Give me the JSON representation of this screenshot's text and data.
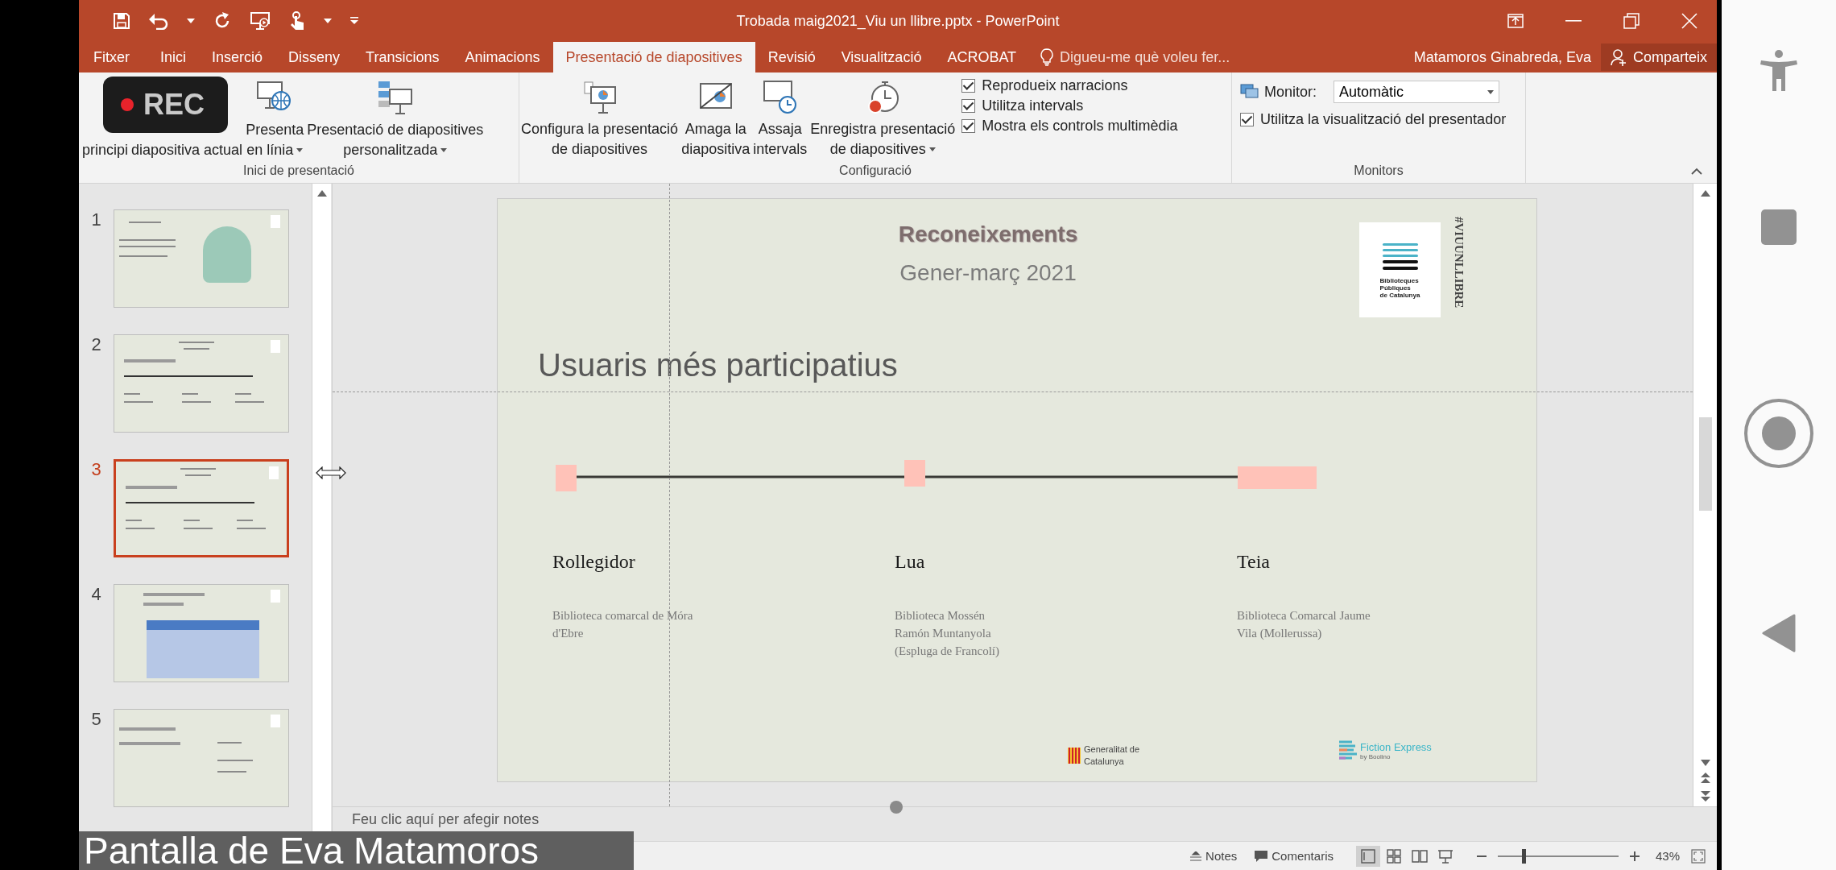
{
  "window": {
    "title": "Trobada maig2021_Viu un llibre.pptx - PowerPoint"
  },
  "tabs": [
    {
      "label": "Fitxer",
      "selected": false
    },
    {
      "label": "Inici",
      "selected": false
    },
    {
      "label": "Inserció",
      "selected": false
    },
    {
      "label": "Disseny",
      "selected": false
    },
    {
      "label": "Transicions",
      "selected": false
    },
    {
      "label": "Animacions",
      "selected": false
    },
    {
      "label": "Presentació de diapositives",
      "selected": true
    },
    {
      "label": "Revisió",
      "selected": false
    },
    {
      "label": "Visualització",
      "selected": false
    },
    {
      "label": "ACROBAT",
      "selected": false
    }
  ],
  "tell_me": {
    "placeholder": "Digueu-me què voleu fer..."
  },
  "user": "Matamoros Ginabreda, Eva",
  "share_button": "Comparteix",
  "recording_badge": "REC",
  "ribbon": {
    "start_group": {
      "label": "Inici de presentació",
      "buttons": [
        {
          "kind": "text",
          "lines": [
            "principi"
          ],
          "dropdown": false
        },
        {
          "kind": "text",
          "lines": [
            "diapositiva actual"
          ],
          "dropdown": false
        },
        {
          "kind": "online",
          "lines": [
            "Presenta",
            "en línia"
          ],
          "dropdown": true
        },
        {
          "kind": "custom",
          "lines": [
            "Presentació de diapositives",
            "personalitzada"
          ],
          "dropdown": true
        }
      ]
    },
    "setup_group": {
      "label": "Configuració",
      "buttons": [
        {
          "kind": "setup",
          "lines": [
            "Configura la presentació",
            "de diapositives"
          ],
          "dropdown": false
        },
        {
          "kind": "hide",
          "lines": [
            "Amaga la",
            "diapositiva"
          ],
          "dropdown": false
        },
        {
          "kind": "rehearse",
          "lines": [
            "Assaja",
            "intervals"
          ],
          "dropdown": false
        },
        {
          "kind": "record",
          "lines": [
            "Enregistra presentació",
            "de diapositives"
          ],
          "dropdown": true
        }
      ],
      "options": [
        {
          "label": "Reprodueix narracions",
          "checked": true
        },
        {
          "label": "Utilitza intervals",
          "checked": true
        },
        {
          "label": "Mostra els controls multimèdia",
          "checked": true
        }
      ]
    },
    "monitors_group": {
      "label": "Monitors",
      "monitor_label": "Monitor:",
      "monitor_value": "Automàtic",
      "options": [
        {
          "label": "Utilitza la visualització del presentador",
          "checked": true
        }
      ]
    }
  },
  "thumbnails": [
    {
      "number": "1",
      "kind": "illustration",
      "selected": false
    },
    {
      "number": "2",
      "kind": "timeline",
      "selected": false
    },
    {
      "number": "3",
      "kind": "timeline",
      "selected": true
    },
    {
      "number": "4",
      "kind": "table",
      "selected": false
    },
    {
      "number": "5",
      "kind": "contacts",
      "selected": false
    }
  ],
  "slide": {
    "title": "Reconeixements",
    "subtitle": "Gener-març 2021",
    "hashtag": "#VIUUNLLIBRE",
    "logo_lines": [
      "Biblioteques",
      "Públiques",
      "de Catalunya"
    ],
    "heading": "Usuaris més participatius",
    "people": [
      {
        "name": "Rollegidor",
        "lines": [
          "Biblioteca comarcal de Móra",
          "d'Ebre"
        ]
      },
      {
        "name": "Lua",
        "lines": [
          "Biblioteca Mossén",
          "Ramón Muntanyola",
          "(Espluga de Francolí)"
        ]
      },
      {
        "name": "Teia",
        "lines": [
          "Biblioteca Comarcal Jaume",
          "Vila (Mollerussa)"
        ]
      }
    ],
    "generalitat_lines": [
      "Generalitat de",
      "Catalunya"
    ],
    "fiction_name": "Fiction Express",
    "fiction_by": "by Boolino"
  },
  "notes": {
    "placeholder": "Feu clic aquí per afegir notes"
  },
  "status_bar": {
    "notes": "Notes",
    "comments": "Comentaris",
    "views": [
      {
        "selected": true
      },
      {
        "selected": false
      },
      {
        "selected": false
      },
      {
        "selected": false
      }
    ],
    "zoom_slider": {
      "level": 0.2
    },
    "zoom": "43%"
  },
  "screen_share_label": "Pantalla de Eva Matamoros"
}
